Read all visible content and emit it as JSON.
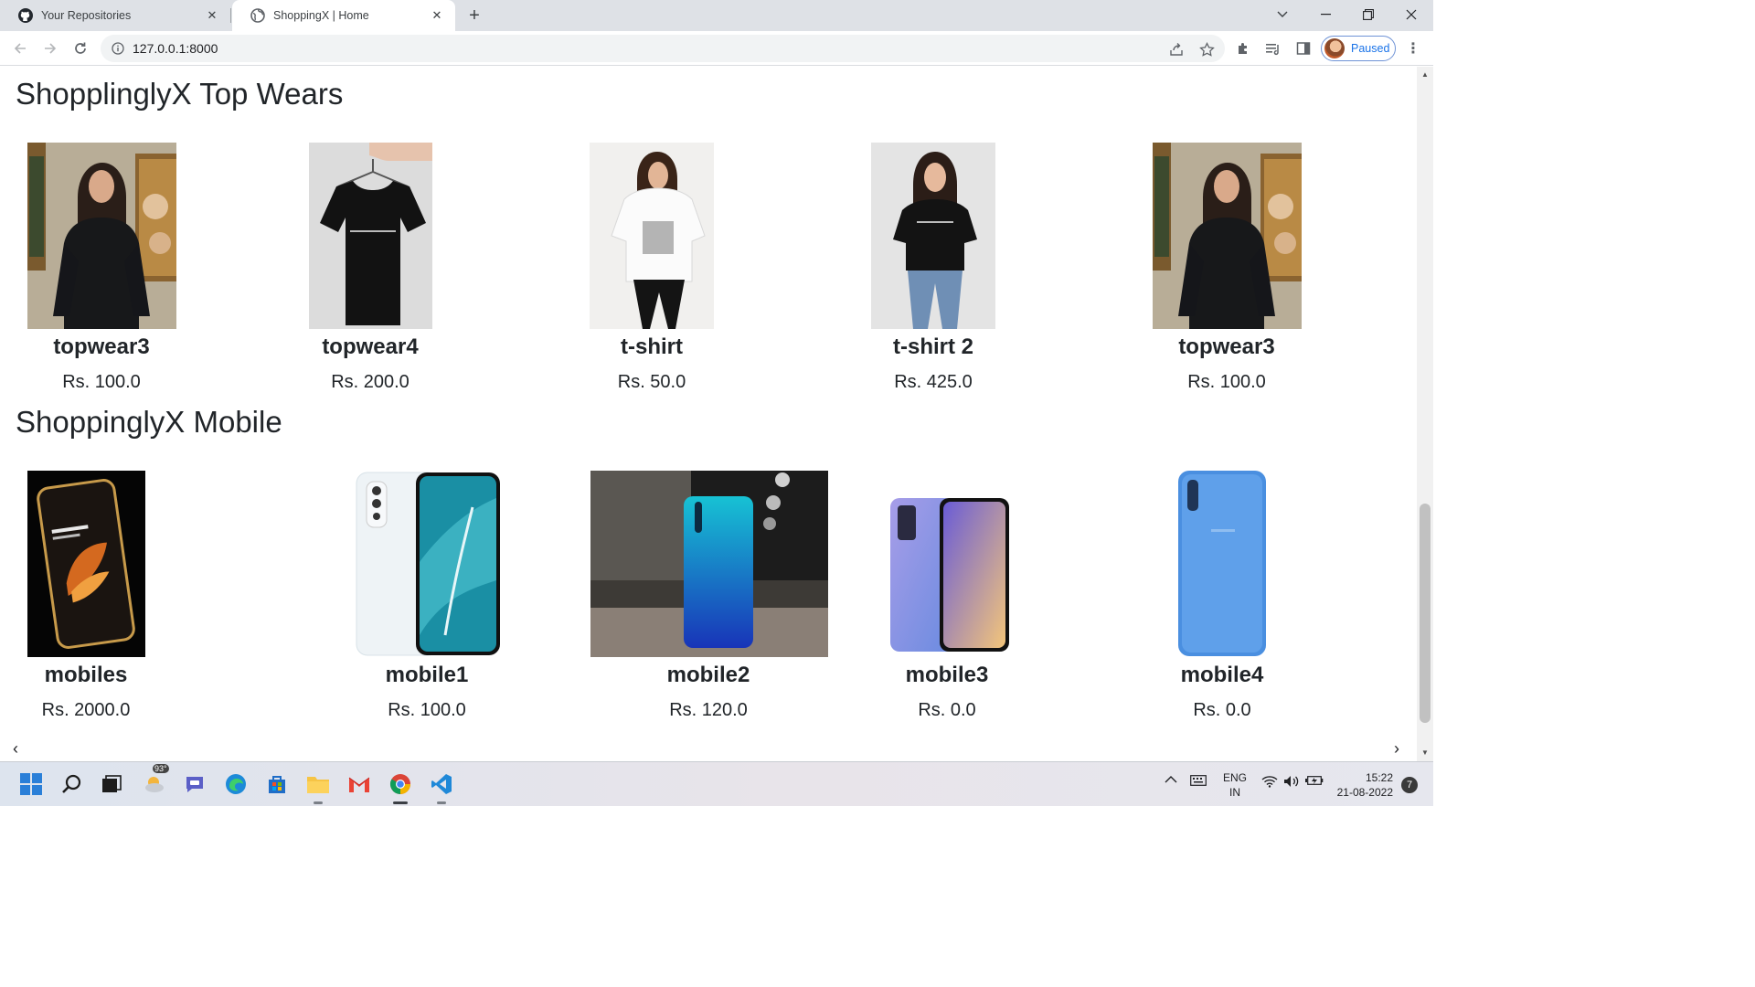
{
  "browser": {
    "tabs": [
      {
        "title": "Your Repositories",
        "favicon": "github-icon",
        "active": false
      },
      {
        "title": "ShoppingX | Home",
        "favicon": "globe-icon",
        "active": true
      }
    ],
    "new_tab_symbol": "+",
    "url": "127.0.0.1:8000",
    "profile_label": "Paused"
  },
  "page": {
    "sections": [
      {
        "title": "ShopplinglyX Top Wears",
        "products": [
          {
            "name": "topwear3",
            "price": "Rs. 100.0",
            "image": "woman-black-tshirt-gallery"
          },
          {
            "name": "topwear4",
            "price": "Rs. 200.0",
            "image": "black-tshirt-on-hanger"
          },
          {
            "name": "t-shirt",
            "price": "Rs. 50.0",
            "image": "woman-white-graphic-tshirt"
          },
          {
            "name": "t-shirt 2",
            "price": "Rs. 425.0",
            "image": "woman-black-tshirt-jeans"
          },
          {
            "name": "topwear3",
            "price": "Rs. 100.0",
            "image": "woman-black-tshirt-gallery"
          }
        ]
      },
      {
        "title": "ShoppinglyX Mobile",
        "products": [
          {
            "name": "mobiles",
            "price": "Rs. 2000.0",
            "image": "dark-smartphone-gold-frame"
          },
          {
            "name": "mobile1",
            "price": "Rs. 100.0",
            "image": "vivo-v17-white"
          },
          {
            "name": "mobile2",
            "price": "Rs. 120.0",
            "image": "vivo-blue-gradient"
          },
          {
            "name": "mobile3",
            "price": "Rs. 0.0",
            "image": "vivo-purple"
          },
          {
            "name": "mobile4",
            "price": "Rs. 0.0",
            "image": "samsung-blue"
          }
        ]
      }
    ]
  },
  "taskbar": {
    "weather_temp": "93°",
    "language": "ENG",
    "region": "IN",
    "time": "15:22",
    "date": "21-08-2022",
    "notification_count": "7"
  }
}
